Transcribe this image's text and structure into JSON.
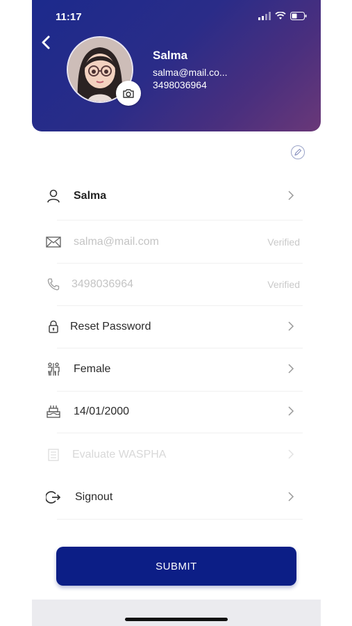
{
  "status_bar": {
    "time": "11:17"
  },
  "header": {
    "name": "Salma",
    "email": "salma@mail.co...",
    "phone": "3498036964"
  },
  "rows": [
    {
      "label": "Salma",
      "meta": "",
      "icon": "user-icon",
      "muted": false,
      "chevron": true
    },
    {
      "label": "salma@mail.com",
      "meta": "Verified",
      "icon": "mail-icon",
      "muted": true,
      "chevron": false
    },
    {
      "label": "3498036964",
      "meta": "Verified",
      "icon": "phone-icon",
      "muted": true,
      "chevron": false
    },
    {
      "label": "Reset Password",
      "meta": "",
      "icon": "lock-icon",
      "muted": false,
      "chevron": true
    },
    {
      "label": "Female",
      "meta": "",
      "icon": "gender-icon",
      "muted": false,
      "chevron": true
    },
    {
      "label": "14/01/2000",
      "meta": "",
      "icon": "cake-icon",
      "muted": false,
      "chevron": true
    },
    {
      "label": "Evaluate WASPHA",
      "meta": "",
      "icon": "document-icon",
      "muted": true,
      "chevron": true
    },
    {
      "label": "Signout",
      "meta": "",
      "icon": "signout-icon",
      "muted": false,
      "chevron": true
    }
  ],
  "submit_label": "SUBMIT",
  "colors": {
    "header_start": "#1c2a8c",
    "header_end": "#6a3878",
    "primary": "#0c1e86"
  }
}
